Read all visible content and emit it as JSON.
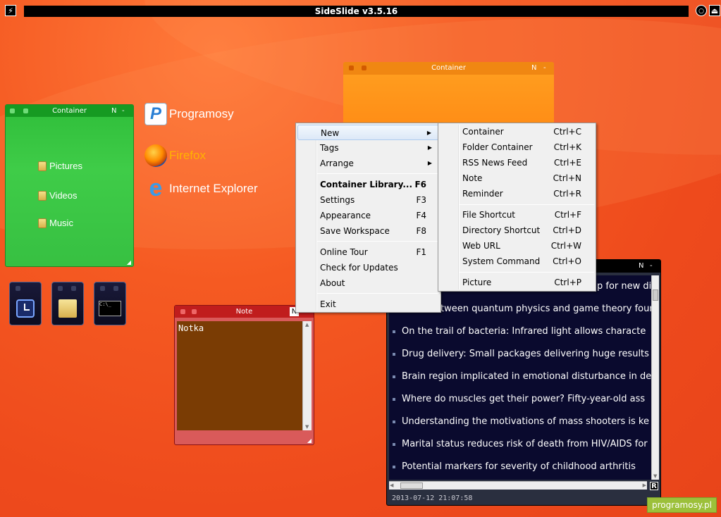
{
  "app": {
    "title": "SideSlide v3.5.16"
  },
  "green_container": {
    "title": "Container",
    "n_label": "N",
    "dash_label": "-",
    "items": [
      {
        "label": "Pictures"
      },
      {
        "label": "Videos"
      },
      {
        "label": "Music"
      }
    ]
  },
  "orange_container": {
    "title": "Container",
    "n_label": "N",
    "dash_label": "-"
  },
  "desktop_shortcuts": [
    {
      "label": "Programosy",
      "color": "#ffffff"
    },
    {
      "label": "Firefox",
      "color": "#ffb300"
    },
    {
      "label": "Internet Explorer",
      "color": "#ffffff"
    }
  ],
  "note": {
    "title": "Note",
    "n_label": "N",
    "body": "Notka"
  },
  "rss": {
    "n_label": "N",
    "dash_label": "-",
    "items": [
      "p for new dia",
      "etween quantum physics and game theory foun",
      "On the trail of bacteria: Infrared light allows characte",
      "Drug delivery: Small packages delivering huge results",
      "Brain region implicated in emotional disturbance in de",
      "Where do muscles get their power? Fifty-year-old ass",
      "Understanding the motivations of mass shooters is ke",
      "Marital status reduces risk of death from HIV/AIDS for",
      "Potential markers for severity of childhood arthritis"
    ],
    "date": "2013-07-12 21:07:58",
    "r_label": "R"
  },
  "context_menu": {
    "items": [
      {
        "label": "New",
        "key": "",
        "submenu": true
      },
      {
        "label": "Tags",
        "key": "",
        "submenu": true
      },
      {
        "label": "Arrange",
        "key": "",
        "submenu": true
      },
      {
        "label": "Container Library...",
        "key": "F6",
        "bold": true
      },
      {
        "label": "Settings",
        "key": "F3"
      },
      {
        "label": "Appearance",
        "key": "F4"
      },
      {
        "label": "Save Workspace",
        "key": "F8"
      },
      {
        "label": "Online Tour",
        "key": "F1"
      },
      {
        "label": "Check for Updates",
        "key": ""
      },
      {
        "label": "About",
        "key": ""
      },
      {
        "label": "Exit",
        "key": ""
      }
    ]
  },
  "submenu": {
    "items": [
      {
        "label": "Container",
        "key": "Ctrl+C"
      },
      {
        "label": "Folder Container",
        "key": "Ctrl+K"
      },
      {
        "label": "RSS News Feed",
        "key": "Ctrl+E"
      },
      {
        "label": "Note",
        "key": "Ctrl+N"
      },
      {
        "label": "Reminder",
        "key": "Ctrl+R"
      },
      {
        "label": "File Shortcut",
        "key": "Ctrl+F"
      },
      {
        "label": "Directory Shortcut",
        "key": "Ctrl+D"
      },
      {
        "label": "Web URL",
        "key": "Ctrl+W"
      },
      {
        "label": "System Command",
        "key": "Ctrl+O"
      },
      {
        "label": "Picture",
        "key": "Ctrl+P"
      }
    ]
  },
  "watermark": "programosy.pl",
  "colors": {
    "background": "#ee4a1c",
    "green": "#3fcc48",
    "orange": "#ff8b15",
    "note_body": "#7a3c04",
    "rss_body": "#0a0a2e"
  }
}
